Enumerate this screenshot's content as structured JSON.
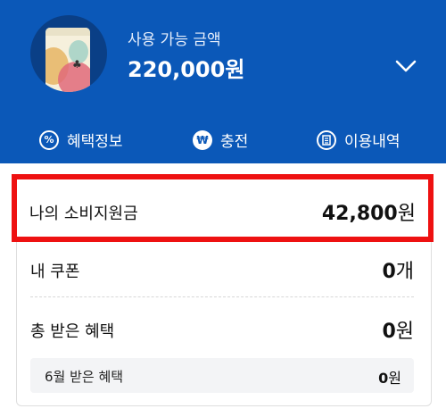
{
  "header": {
    "balance_label": "사용 가능 금액",
    "balance_value": "220,000원",
    "chevron_icon": "chevron-down-icon",
    "accent_color": "#0b58b8"
  },
  "tabs": [
    {
      "icon": "percent-icon",
      "label": "혜택정보"
    },
    {
      "icon": "won-icon",
      "label": "충전"
    },
    {
      "icon": "list-icon",
      "label": "이용내역"
    }
  ],
  "summary": {
    "subsidy_label": "나의 소비지원금",
    "subsidy_amount": "42,800",
    "subsidy_unit": "원",
    "coupon_label": "내 쿠폰",
    "coupon_count": "0",
    "coupon_unit": "개",
    "benefit_label": "총 받은 혜택",
    "benefit_amount": "0",
    "benefit_unit": "원",
    "monthly_label": "6월 받은 혜택",
    "monthly_amount": "0",
    "monthly_unit": "원"
  },
  "highlight_color": "#ee1111"
}
